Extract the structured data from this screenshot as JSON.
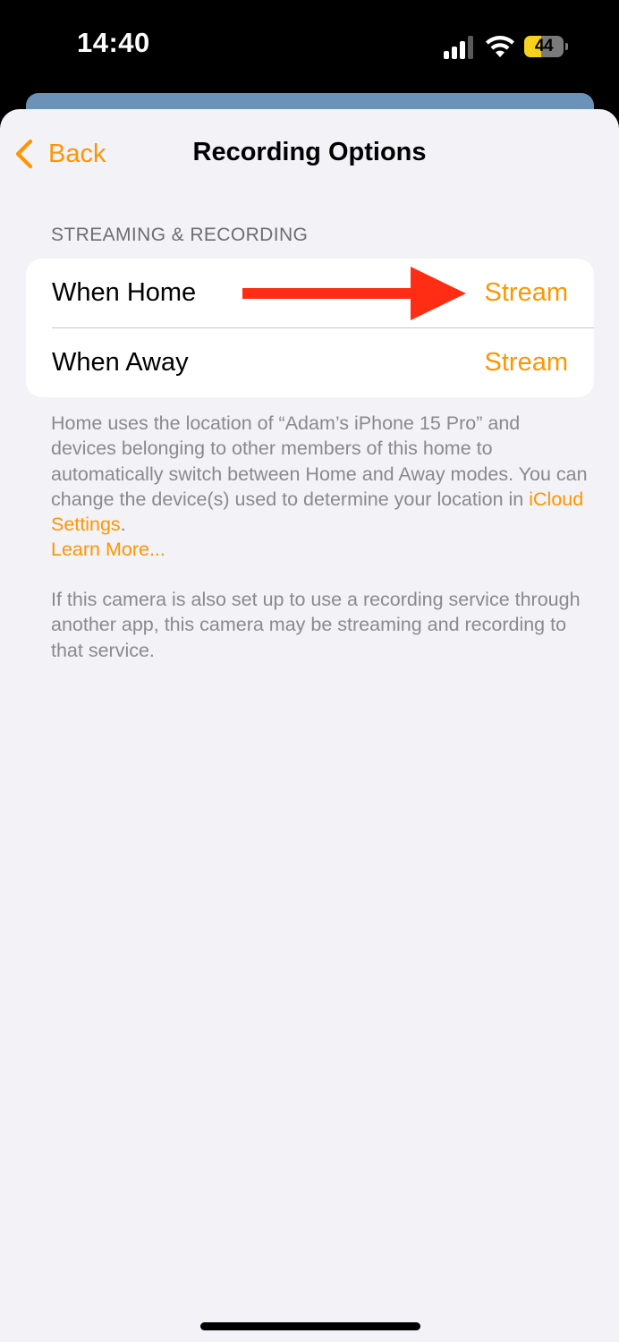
{
  "status_bar": {
    "time": "14:40",
    "battery_level": "44",
    "battery_fraction": 0.44,
    "signal_bars_active": 3,
    "signal_bars_total": 4,
    "icons": [
      "cellular-signal-icon",
      "wifi-icon",
      "battery-icon"
    ]
  },
  "nav": {
    "back_label": "Back",
    "title": "Recording Options"
  },
  "section": {
    "header": "STREAMING & RECORDING",
    "rows": [
      {
        "label": "When Home",
        "value": "Stream"
      },
      {
        "label": "When Away",
        "value": "Stream"
      }
    ]
  },
  "footer": {
    "info_text_before_link": "Home uses the location of “Adam’s iPhone 15 Pro” and devices belonging to other members of this home to automatically switch between Home and Away modes. You can change the device(s) used to determine your location in ",
    "icloud_link": "iCloud Settings",
    "info_text_after_link": ".",
    "learn_more": "Learn More...",
    "note": "If this camera is also set up to use a recording service through another app, this camera may be streaming and recording to that service."
  },
  "colors": {
    "accent": "#ff9500",
    "annotation_arrow": "#ff2d14",
    "sheet_background": "#f2f2f7",
    "card_background": "#ffffff",
    "secondary_text": "#8a8a8e",
    "battery_fill": "#f7d21c",
    "back_sheet": "#6b92b9"
  }
}
